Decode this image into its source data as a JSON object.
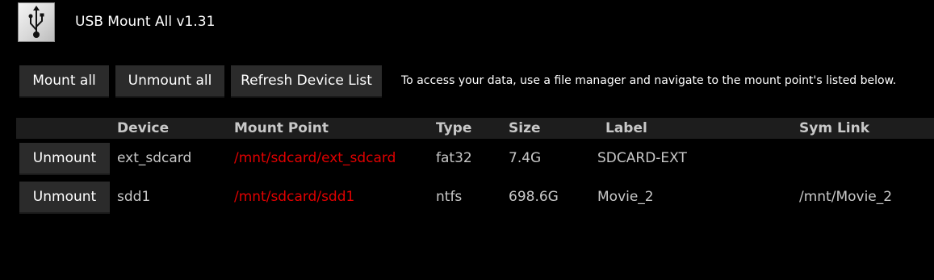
{
  "app": {
    "title": "USB Mount All v1.31",
    "icon": "usb-icon"
  },
  "toolbar": {
    "mount_all": "Mount all",
    "unmount_all": "Unmount all",
    "refresh": "Refresh Device List",
    "hint": "To access your data, use a file manager and navigate to the mount point's listed below."
  },
  "table": {
    "columns": [
      "Device",
      "Mount Point",
      "Type",
      "Size",
      "Label",
      "Sym Link"
    ],
    "rows": [
      {
        "action": "Unmount",
        "device": "ext_sdcard",
        "mount_point": "/mnt/sdcard/ext_sdcard",
        "type": "fat32",
        "size": "7.4G",
        "label": "SDCARD-EXT",
        "sym_link": ""
      },
      {
        "action": "Unmount",
        "device": "sdd1",
        "mount_point": "/mnt/sdcard/sdd1",
        "type": "ntfs",
        "size": "698.6G",
        "label": "Movie_2",
        "sym_link": "/mnt/Movie_2"
      }
    ]
  },
  "colors": {
    "background": "#000000",
    "button": "#2b2b2b",
    "header_bar": "#1d1d1d",
    "text": "#c8c8c8",
    "mount_point": "#e00000"
  }
}
